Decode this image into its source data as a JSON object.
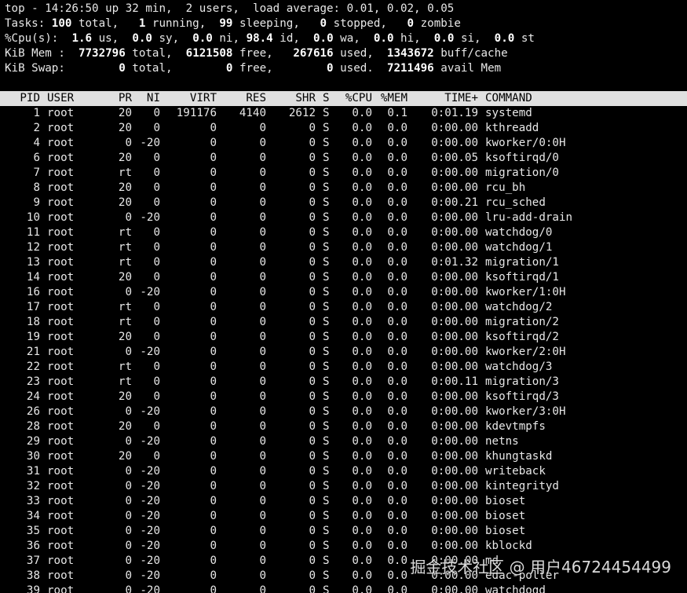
{
  "summary": {
    "line1": "top - 14:26:50 up 32 min,  2 users,  load average: 0.01, 0.02, 0.05",
    "tasks": {
      "prefix": "Tasks:",
      "total": "100",
      "total_label": " total,",
      "running": "1",
      "running_label": " running,",
      "sleeping": "99",
      "sleeping_label": " sleeping,",
      "stopped": "0",
      "stopped_label": " stopped,",
      "zombie": "0",
      "zombie_label": " zombie"
    },
    "cpu": {
      "prefix": "%Cpu(s):",
      "us": "1.6",
      "us_label": " us,",
      "sy": "0.0",
      "sy_label": " sy,",
      "ni": "0.0",
      "ni_label": " ni,",
      "id": "98.4",
      "id_label": " id,",
      "wa": "0.0",
      "wa_label": " wa,",
      "hi": "0.0",
      "hi_label": " hi,",
      "si": "0.0",
      "si_label": " si,",
      "st": "0.0",
      "st_label": " st"
    },
    "mem": {
      "prefix": "KiB Mem :",
      "total": "7732796",
      "total_label": " total,",
      "free": "6121508",
      "free_label": " free,",
      "used": "267616",
      "used_label": " used,",
      "buff": "1343672",
      "buff_label": " buff/cache"
    },
    "swap": {
      "prefix": "KiB Swap:",
      "total": "0",
      "total_label": " total,",
      "free": "0",
      "free_label": " free,",
      "used": "0",
      "used_label": " used.",
      "avail": "7211496",
      "avail_label": " avail Mem"
    }
  },
  "columns": [
    "PID",
    "USER",
    "PR",
    "NI",
    "VIRT",
    "RES",
    "SHR",
    "S",
    "%CPU",
    "%MEM",
    "TIME+",
    "COMMAND"
  ],
  "processes": [
    [
      "1",
      "root",
      "20",
      "0",
      "191176",
      "4140",
      "2612",
      "S",
      "0.0",
      "0.1",
      "0:01.19",
      "systemd"
    ],
    [
      "2",
      "root",
      "20",
      "0",
      "0",
      "0",
      "0",
      "S",
      "0.0",
      "0.0",
      "0:00.00",
      "kthreadd"
    ],
    [
      "4",
      "root",
      "0",
      "-20",
      "0",
      "0",
      "0",
      "S",
      "0.0",
      "0.0",
      "0:00.00",
      "kworker/0:0H"
    ],
    [
      "6",
      "root",
      "20",
      "0",
      "0",
      "0",
      "0",
      "S",
      "0.0",
      "0.0",
      "0:00.05",
      "ksoftirqd/0"
    ],
    [
      "7",
      "root",
      "rt",
      "0",
      "0",
      "0",
      "0",
      "S",
      "0.0",
      "0.0",
      "0:00.00",
      "migration/0"
    ],
    [
      "8",
      "root",
      "20",
      "0",
      "0",
      "0",
      "0",
      "S",
      "0.0",
      "0.0",
      "0:00.00",
      "rcu_bh"
    ],
    [
      "9",
      "root",
      "20",
      "0",
      "0",
      "0",
      "0",
      "S",
      "0.0",
      "0.0",
      "0:00.21",
      "rcu_sched"
    ],
    [
      "10",
      "root",
      "0",
      "-20",
      "0",
      "0",
      "0",
      "S",
      "0.0",
      "0.0",
      "0:00.00",
      "lru-add-drain"
    ],
    [
      "11",
      "root",
      "rt",
      "0",
      "0",
      "0",
      "0",
      "S",
      "0.0",
      "0.0",
      "0:00.00",
      "watchdog/0"
    ],
    [
      "12",
      "root",
      "rt",
      "0",
      "0",
      "0",
      "0",
      "S",
      "0.0",
      "0.0",
      "0:00.00",
      "watchdog/1"
    ],
    [
      "13",
      "root",
      "rt",
      "0",
      "0",
      "0",
      "0",
      "S",
      "0.0",
      "0.0",
      "0:01.32",
      "migration/1"
    ],
    [
      "14",
      "root",
      "20",
      "0",
      "0",
      "0",
      "0",
      "S",
      "0.0",
      "0.0",
      "0:00.00",
      "ksoftirqd/1"
    ],
    [
      "16",
      "root",
      "0",
      "-20",
      "0",
      "0",
      "0",
      "S",
      "0.0",
      "0.0",
      "0:00.00",
      "kworker/1:0H"
    ],
    [
      "17",
      "root",
      "rt",
      "0",
      "0",
      "0",
      "0",
      "S",
      "0.0",
      "0.0",
      "0:00.00",
      "watchdog/2"
    ],
    [
      "18",
      "root",
      "rt",
      "0",
      "0",
      "0",
      "0",
      "S",
      "0.0",
      "0.0",
      "0:00.00",
      "migration/2"
    ],
    [
      "19",
      "root",
      "20",
      "0",
      "0",
      "0",
      "0",
      "S",
      "0.0",
      "0.0",
      "0:00.00",
      "ksoftirqd/2"
    ],
    [
      "21",
      "root",
      "0",
      "-20",
      "0",
      "0",
      "0",
      "S",
      "0.0",
      "0.0",
      "0:00.00",
      "kworker/2:0H"
    ],
    [
      "22",
      "root",
      "rt",
      "0",
      "0",
      "0",
      "0",
      "S",
      "0.0",
      "0.0",
      "0:00.00",
      "watchdog/3"
    ],
    [
      "23",
      "root",
      "rt",
      "0",
      "0",
      "0",
      "0",
      "S",
      "0.0",
      "0.0",
      "0:00.11",
      "migration/3"
    ],
    [
      "24",
      "root",
      "20",
      "0",
      "0",
      "0",
      "0",
      "S",
      "0.0",
      "0.0",
      "0:00.00",
      "ksoftirqd/3"
    ],
    [
      "26",
      "root",
      "0",
      "-20",
      "0",
      "0",
      "0",
      "S",
      "0.0",
      "0.0",
      "0:00.00",
      "kworker/3:0H"
    ],
    [
      "28",
      "root",
      "20",
      "0",
      "0",
      "0",
      "0",
      "S",
      "0.0",
      "0.0",
      "0:00.00",
      "kdevtmpfs"
    ],
    [
      "29",
      "root",
      "0",
      "-20",
      "0",
      "0",
      "0",
      "S",
      "0.0",
      "0.0",
      "0:00.00",
      "netns"
    ],
    [
      "30",
      "root",
      "20",
      "0",
      "0",
      "0",
      "0",
      "S",
      "0.0",
      "0.0",
      "0:00.00",
      "khungtaskd"
    ],
    [
      "31",
      "root",
      "0",
      "-20",
      "0",
      "0",
      "0",
      "S",
      "0.0",
      "0.0",
      "0:00.00",
      "writeback"
    ],
    [
      "32",
      "root",
      "0",
      "-20",
      "0",
      "0",
      "0",
      "S",
      "0.0",
      "0.0",
      "0:00.00",
      "kintegrityd"
    ],
    [
      "33",
      "root",
      "0",
      "-20",
      "0",
      "0",
      "0",
      "S",
      "0.0",
      "0.0",
      "0:00.00",
      "bioset"
    ],
    [
      "34",
      "root",
      "0",
      "-20",
      "0",
      "0",
      "0",
      "S",
      "0.0",
      "0.0",
      "0:00.00",
      "bioset"
    ],
    [
      "35",
      "root",
      "0",
      "-20",
      "0",
      "0",
      "0",
      "S",
      "0.0",
      "0.0",
      "0:00.00",
      "bioset"
    ],
    [
      "36",
      "root",
      "0",
      "-20",
      "0",
      "0",
      "0",
      "S",
      "0.0",
      "0.0",
      "0:00.00",
      "kblockd"
    ],
    [
      "37",
      "root",
      "0",
      "-20",
      "0",
      "0",
      "0",
      "S",
      "0.0",
      "0.0",
      "0:00.00",
      "md"
    ],
    [
      "38",
      "root",
      "0",
      "-20",
      "0",
      "0",
      "0",
      "S",
      "0.0",
      "0.0",
      "0:00.00",
      "edac-poller"
    ],
    [
      "39",
      "root",
      "0",
      "-20",
      "0",
      "0",
      "0",
      "S",
      "0.0",
      "0.0",
      "0:00.00",
      "watchdogd"
    ]
  ],
  "watermark": "掘金技术社区 @ 用户46724454499",
  "colors": {
    "background": "#000000",
    "text": "#e8e8e8",
    "header_bar": "#e0e0e0",
    "header_text": "#000000"
  }
}
